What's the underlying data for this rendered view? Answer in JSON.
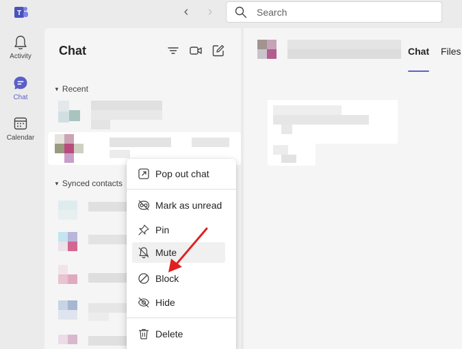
{
  "topbar": {
    "search_placeholder": "Search"
  },
  "rail": {
    "items": [
      {
        "label": "Activity",
        "icon": "bell-icon"
      },
      {
        "label": "Chat",
        "icon": "chat-icon",
        "active": true
      },
      {
        "label": "Calendar",
        "icon": "calendar-icon"
      }
    ]
  },
  "chat_list": {
    "title": "Chat",
    "sections": {
      "recent": "Recent",
      "synced": "Synced contacts"
    }
  },
  "main": {
    "tabs": [
      {
        "label": "Chat",
        "active": true
      },
      {
        "label": "Files",
        "active": false
      }
    ]
  },
  "context_menu": {
    "items": [
      {
        "label": "Pop out chat",
        "icon": "pop-out-icon"
      },
      {
        "label": "Mark as unread",
        "icon": "unread-icon"
      },
      {
        "label": "Pin",
        "icon": "pin-icon"
      },
      {
        "label": "Mute",
        "icon": "bell-off-icon",
        "hovered": true
      },
      {
        "label": "Block",
        "icon": "block-icon"
      },
      {
        "label": "Hide",
        "icon": "eye-off-icon"
      },
      {
        "label": "Delete",
        "icon": "trash-icon"
      }
    ]
  },
  "colors": {
    "accent": "#5b5fc7",
    "annotation_arrow": "#e02020"
  }
}
